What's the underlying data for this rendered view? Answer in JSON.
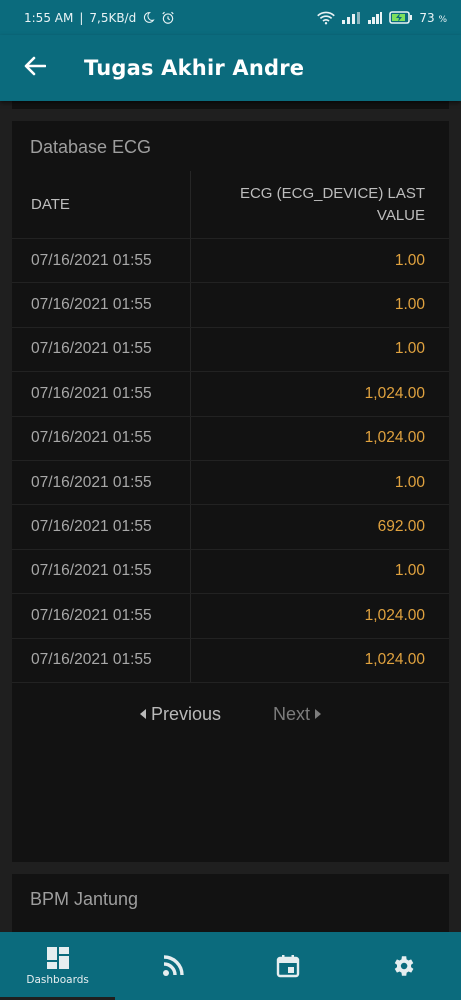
{
  "status_bar": {
    "time": "1:55 AM",
    "network_speed": "7,5KB/d",
    "battery_percent": "73",
    "battery_suffix": "%"
  },
  "app_bar": {
    "title": "Tugas Akhir Andre",
    "back_icon": "arrow-back-icon"
  },
  "ecg_card": {
    "title": "Database ECG",
    "columns": [
      "DATE",
      "ECG (ECG_DEVICE) LAST VALUE"
    ],
    "rows": [
      {
        "date": "07/16/2021 01:55",
        "value": "1.00"
      },
      {
        "date": "07/16/2021 01:55",
        "value": "1.00"
      },
      {
        "date": "07/16/2021 01:55",
        "value": "1.00"
      },
      {
        "date": "07/16/2021 01:55",
        "value": "1,024.00"
      },
      {
        "date": "07/16/2021 01:55",
        "value": "1,024.00"
      },
      {
        "date": "07/16/2021 01:55",
        "value": "1.00"
      },
      {
        "date": "07/16/2021 01:55",
        "value": "692.00"
      },
      {
        "date": "07/16/2021 01:55",
        "value": "1.00"
      },
      {
        "date": "07/16/2021 01:55",
        "value": "1,024.00"
      },
      {
        "date": "07/16/2021 01:55",
        "value": "1,024.00"
      }
    ],
    "pager": {
      "previous_label": "Previous",
      "next_label": "Next"
    }
  },
  "bpm_card": {
    "title": "BPM Jantung"
  },
  "bottom_nav": {
    "items": [
      {
        "label": "Dashboards",
        "icon": "dashboard-icon",
        "active": true
      },
      {
        "label": "",
        "icon": "rss-feed-icon",
        "active": false
      },
      {
        "label": "",
        "icon": "calendar-event-icon",
        "active": false
      },
      {
        "label": "",
        "icon": "settings-gear-icon",
        "active": false
      }
    ]
  },
  "colors": {
    "primary": "#0b6b7d",
    "background": "#1f1f1f",
    "card": "#121212",
    "value_accent": "#e0a23f"
  }
}
